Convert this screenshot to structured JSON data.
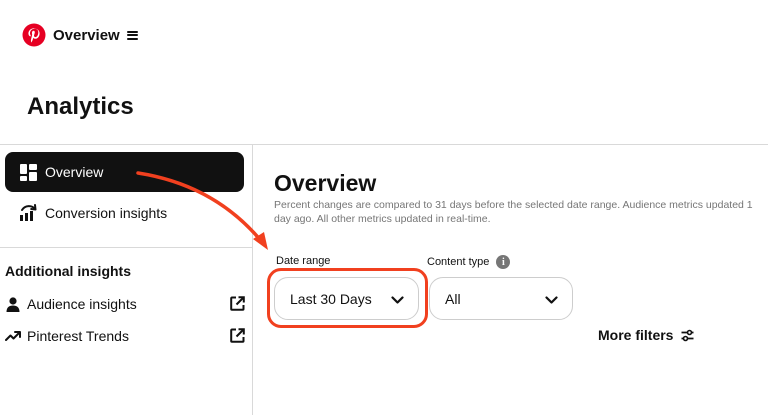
{
  "header": {
    "logo_icon": "pinterest-logo",
    "menu_label": "Overview",
    "menu_icon": "hamburger-icon",
    "brand_color": "#E60023"
  },
  "page_title": "Analytics",
  "sidebar": {
    "items": [
      {
        "label": "Overview",
        "icon": "dashboard-grid-icon",
        "active": true
      },
      {
        "label": "Conversion insights",
        "icon": "conversion-chart-icon",
        "active": false
      }
    ],
    "section_title": "Additional insights",
    "links": [
      {
        "label": "Audience insights",
        "icon": "person-icon",
        "external_icon": "external-link-icon"
      },
      {
        "label": "Pinterest Trends",
        "icon": "trend-arrow-icon",
        "external_icon": "external-link-icon"
      }
    ]
  },
  "main": {
    "title": "Overview",
    "description": "Percent changes are compared to 31 days before the selected date range. Audience metrics updated 1 day ago. All other metrics updated in real-time.",
    "filters": {
      "date_range": {
        "label": "Date range",
        "value": "Last 30 Days"
      },
      "content_type": {
        "label": "Content type",
        "value": "All",
        "info_icon": "info-icon"
      }
    },
    "more_filters": {
      "label": "More filters",
      "icon": "sliders-icon"
    }
  },
  "annotation": {
    "color": "#F1401F"
  }
}
